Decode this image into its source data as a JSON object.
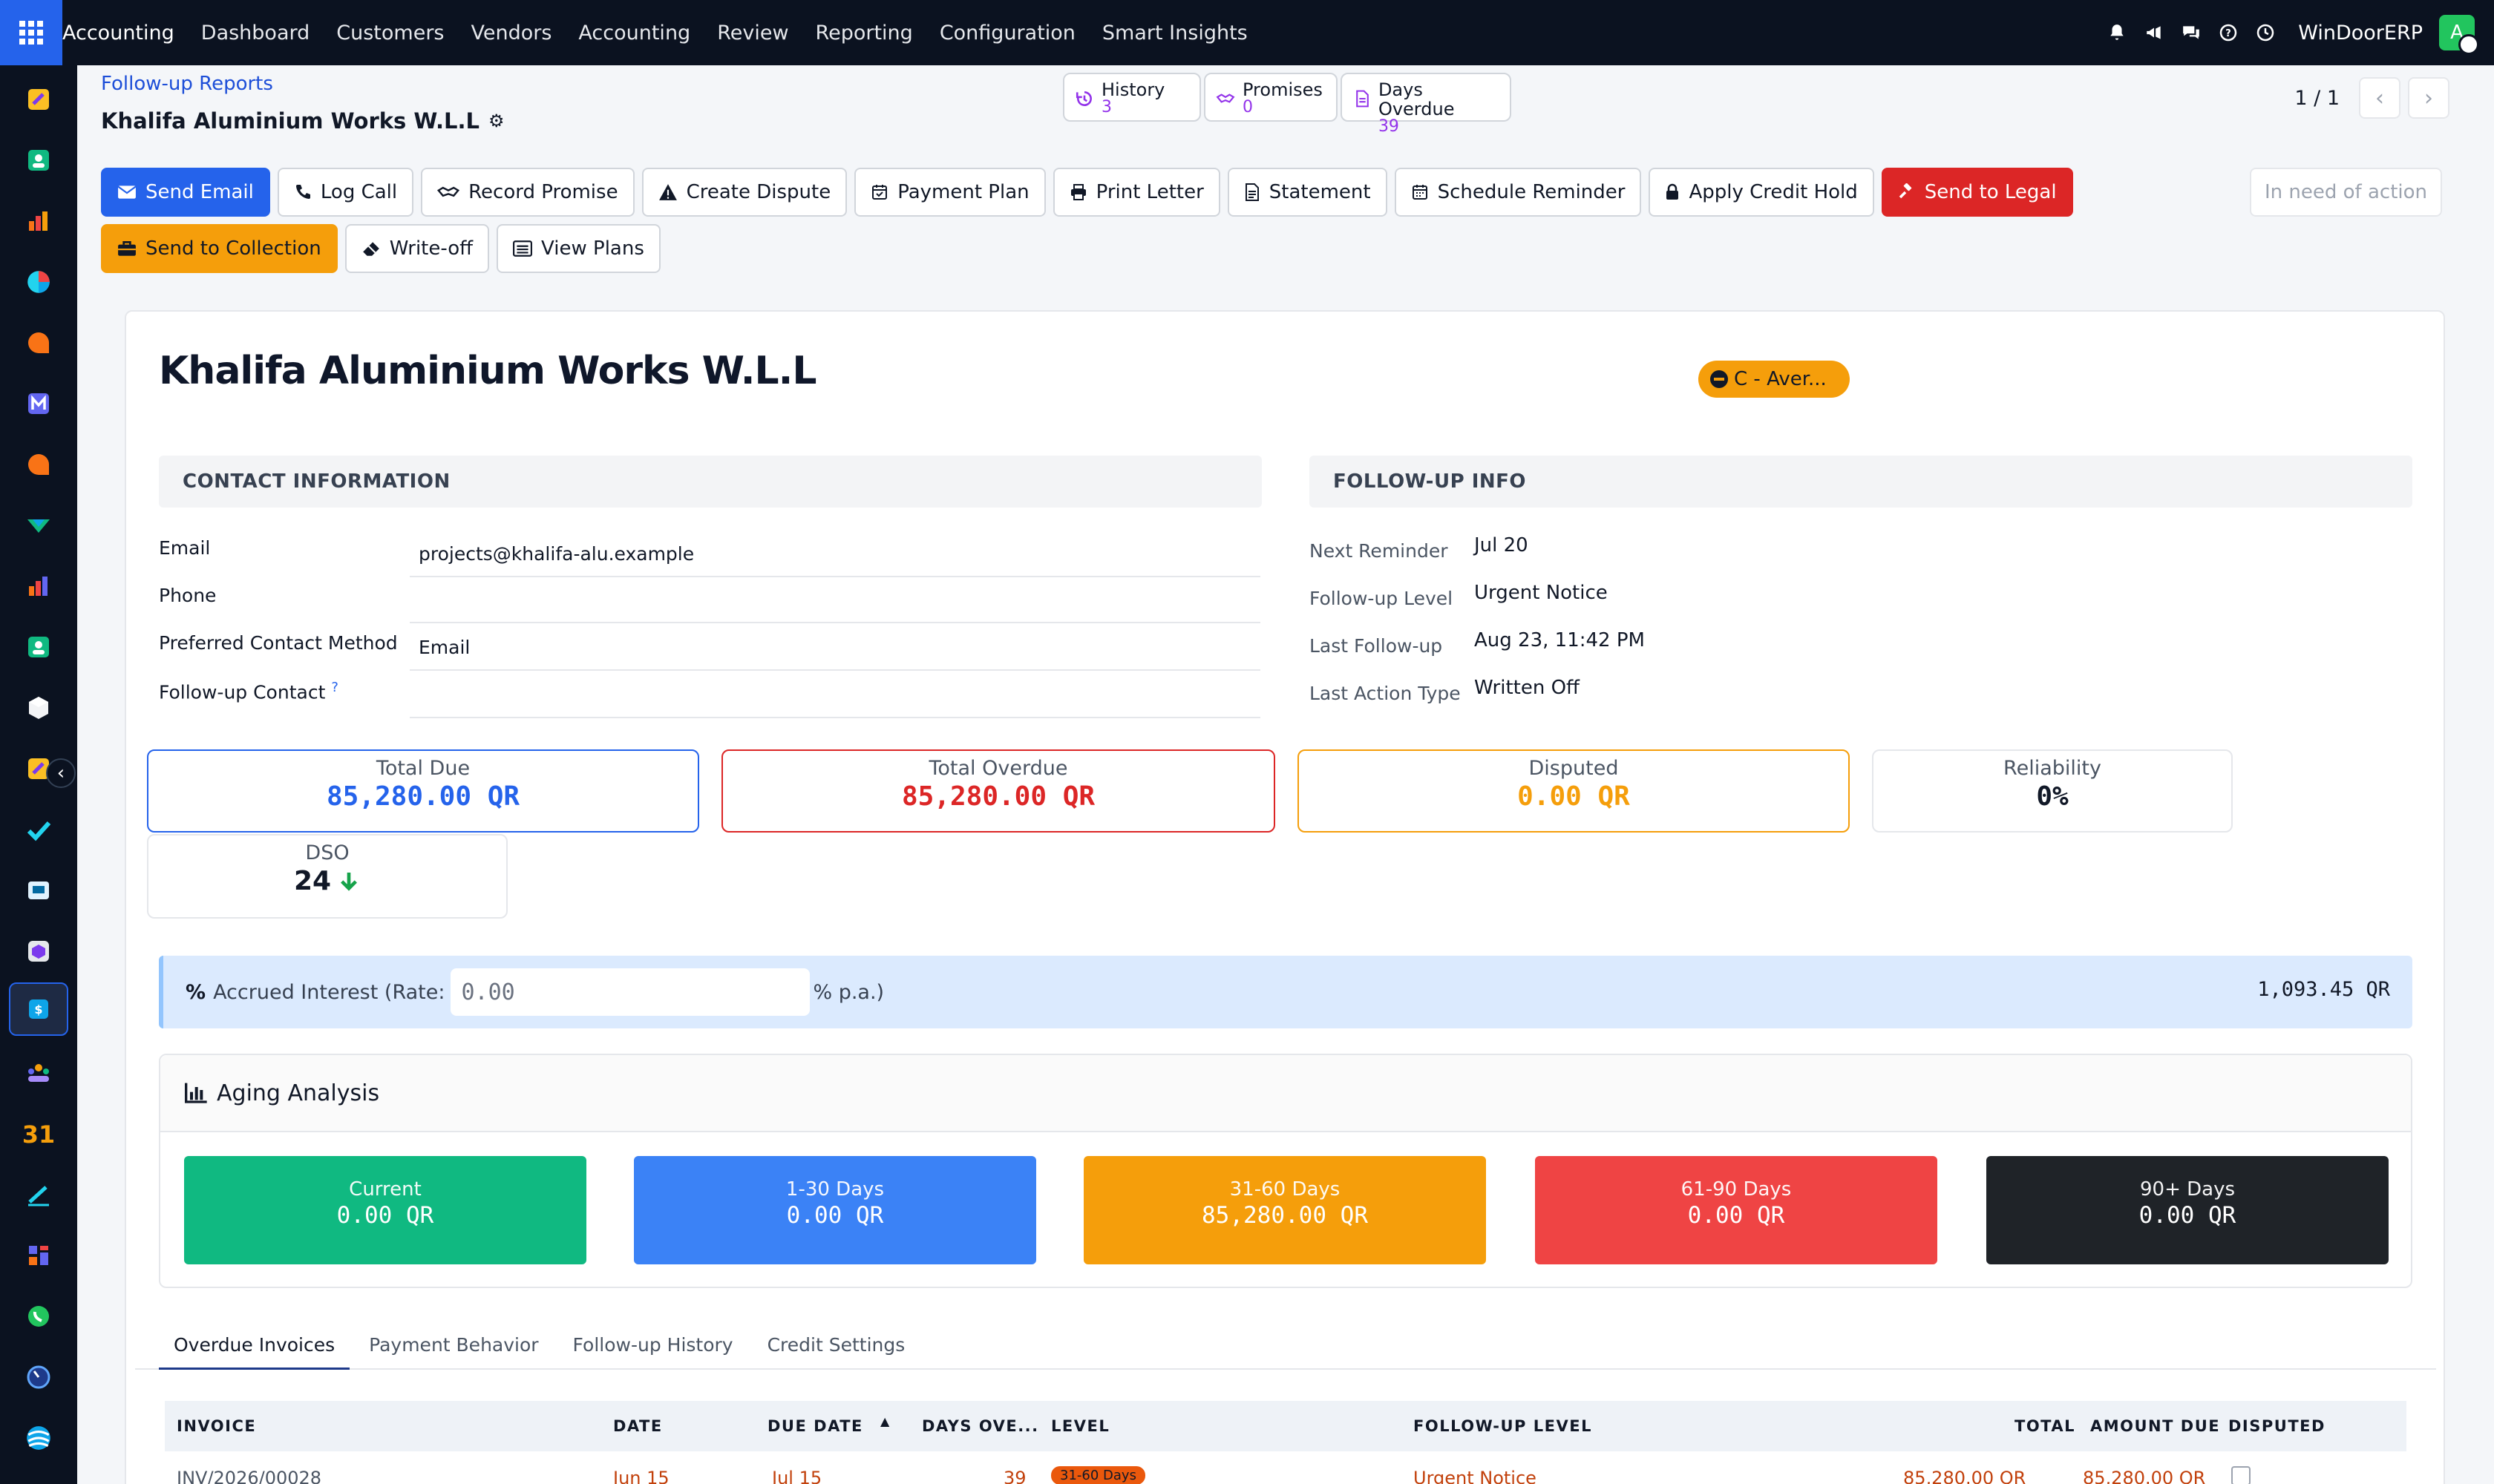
{
  "topbar": {
    "brand": "Accounting",
    "nav": [
      "Dashboard",
      "Customers",
      "Vendors",
      "Accounting",
      "Review",
      "Reporting",
      "Configuration",
      "Smart Insights"
    ],
    "company": "WinDoorERP",
    "avatar_initial": "A"
  },
  "header": {
    "breadcrumb": "Follow-up Reports",
    "title": "Khalifa Aluminium Works W.L.L",
    "pager": "1 / 1"
  },
  "stat_buttons": [
    {
      "label": "History",
      "value": "3",
      "icon": "history-icon"
    },
    {
      "label": "Promises",
      "value": "0",
      "icon": "handshake-icon"
    },
    {
      "label": "Days Overdue",
      "value": "39",
      "icon": "file-icon"
    }
  ],
  "actions": [
    {
      "label": "Send Email",
      "icon": "envelope-icon"
    },
    {
      "label": "Log Call",
      "icon": "phone-icon"
    },
    {
      "label": "Record Promise",
      "icon": "handshake-icon"
    },
    {
      "label": "Create Dispute",
      "icon": "warning-icon"
    },
    {
      "label": "Payment Plan",
      "icon": "calendar-check-icon"
    },
    {
      "label": "Print Letter",
      "icon": "printer-icon"
    },
    {
      "label": "Statement",
      "icon": "document-icon"
    },
    {
      "label": "Schedule Reminder",
      "icon": "calendar-icon"
    },
    {
      "label": "Apply Credit Hold",
      "icon": "lock-icon"
    },
    {
      "label": "Send to Legal",
      "icon": "gavel-icon"
    },
    {
      "label": "Send to Collection",
      "icon": "briefcase-icon"
    },
    {
      "label": "Write-off",
      "icon": "eraser-icon"
    },
    {
      "label": "View Plans",
      "icon": "list-icon"
    }
  ],
  "status_label": "In need of action",
  "partner": {
    "name": "Khalifa Aluminium Works W.L.L",
    "badge": "C - Aver..."
  },
  "contact": {
    "heading": "CONTACT INFORMATION",
    "email_label": "Email",
    "email": "projects@khalifa-alu.example",
    "phone_label": "Phone",
    "phone": "",
    "method_label": "Preferred Contact Method",
    "method": "Email",
    "fu_contact_label": "Follow-up Contact",
    "fu_contact_help": "?",
    "fu_contact": ""
  },
  "followup": {
    "heading": "FOLLOW-UP INFO",
    "next_reminder_label": "Next Reminder",
    "next_reminder": "Jul 20",
    "level_label": "Follow-up Level",
    "level": "Urgent Notice",
    "last_fu_label": "Last Follow-up",
    "last_fu": "Aug 23, 11:42 PM",
    "last_action_label": "Last Action Type",
    "last_action": "Written Off"
  },
  "kpis": {
    "total_due_label": "Total Due",
    "total_due": "85,280.00 QR",
    "total_overdue_label": "Total Overdue",
    "total_overdue": "85,280.00 QR",
    "disputed_label": "Disputed",
    "disputed": "0.00 QR",
    "reliability_label": "Reliability",
    "reliability": "0%",
    "dso_label": "DSO",
    "dso": "24"
  },
  "interest": {
    "label": "Accrued Interest (Rate:",
    "rate": "0.00",
    "unit": "% p.a.)",
    "amount": "1,093.45 QR"
  },
  "aging": {
    "title": "Aging Analysis",
    "buckets": [
      {
        "label": "Current",
        "value": "0.00 QR",
        "color": "#10b981"
      },
      {
        "label": "1-30 Days",
        "value": "0.00 QR",
        "color": "#3b82f6"
      },
      {
        "label": "31-60 Days",
        "value": "85,280.00 QR",
        "color": "#f59e0b"
      },
      {
        "label": "61-90 Days",
        "value": "0.00 QR",
        "color": "#ef4444"
      },
      {
        "label": "90+ Days",
        "value": "0.00 QR",
        "color": "#1f2328"
      }
    ]
  },
  "tabs": [
    "Overdue Invoices",
    "Payment Behavior",
    "Follow-up History",
    "Credit Settings"
  ],
  "table": {
    "columns": [
      "INVOICE",
      "DATE",
      "DUE DATE",
      "DAYS OVE...",
      "LEVEL",
      "FOLLOW-UP LEVEL",
      "TOTAL",
      "AMOUNT DUE",
      "DISPUTED"
    ],
    "rows": [
      {
        "invoice": "INV/2026/00028",
        "date": "Jun 15",
        "due": "Jul 15",
        "days": "39",
        "level": "31-60 Days",
        "fu_level": "Urgent Notice",
        "total": "85,280.00 QR",
        "amount_due": "85,280.00 QR"
      }
    ]
  },
  "colors": {
    "accent": "#2563eb",
    "danger": "#dc2626",
    "warning": "#f59e0b",
    "nav_bg": "#0b1220"
  }
}
